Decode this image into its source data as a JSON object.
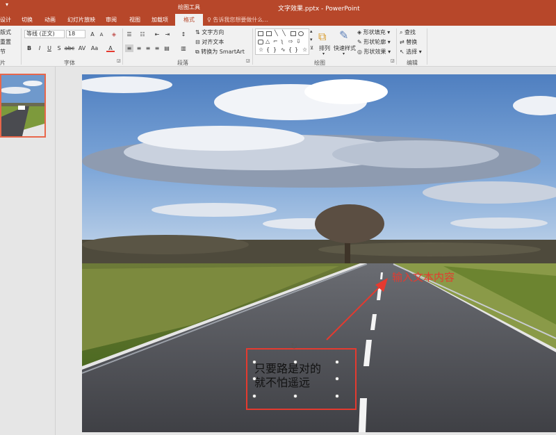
{
  "window": {
    "title": "文字效果.pptx - PowerPoint",
    "contextual_group": "绘图工具"
  },
  "tabs": [
    "设计",
    "切换",
    "动画",
    "幻灯片放映",
    "审阅",
    "视图",
    "加载项"
  ],
  "active_tab": "格式",
  "tell_me": "告诉我您想要做什么...",
  "ribbon": {
    "slides_group": {
      "layout": "版式",
      "reset": "重置",
      "section": "节",
      "label": "片"
    },
    "font_group": {
      "font_name": "等线 (正文)",
      "font_size": "18",
      "bold": "B",
      "italic": "I",
      "underline": "U",
      "strike": "S",
      "strike2": "abc",
      "spacing": "AV",
      "case": "Aa",
      "color": "A",
      "grow": "A",
      "shrink": "A",
      "label": "字体"
    },
    "paragraph_group": {
      "text_direction": "文字方向",
      "align_text": "对齐文本",
      "smartart": "转换为 SmartArt",
      "label": "段落"
    },
    "drawing_group": {
      "arrange": "排列",
      "quick_styles": "快速样式",
      "shape_fill": "形状填充",
      "shape_outline": "形状轮廓",
      "shape_effects": "形状效果",
      "label": "绘图"
    },
    "editing_group": {
      "find": "查找",
      "replace": "替换",
      "select": "选择",
      "label": "编辑"
    }
  },
  "slide": {
    "annotation": "输入文本内容",
    "textbox_lines": [
      "只要路是对的",
      "就不怕遥远"
    ]
  },
  "colors": {
    "titlebar": "#b7472a",
    "annotation_red": "#e53a2f",
    "sky": "#5b8ac4",
    "grass": "#5e7a2c",
    "road": "#4a4b4f"
  }
}
